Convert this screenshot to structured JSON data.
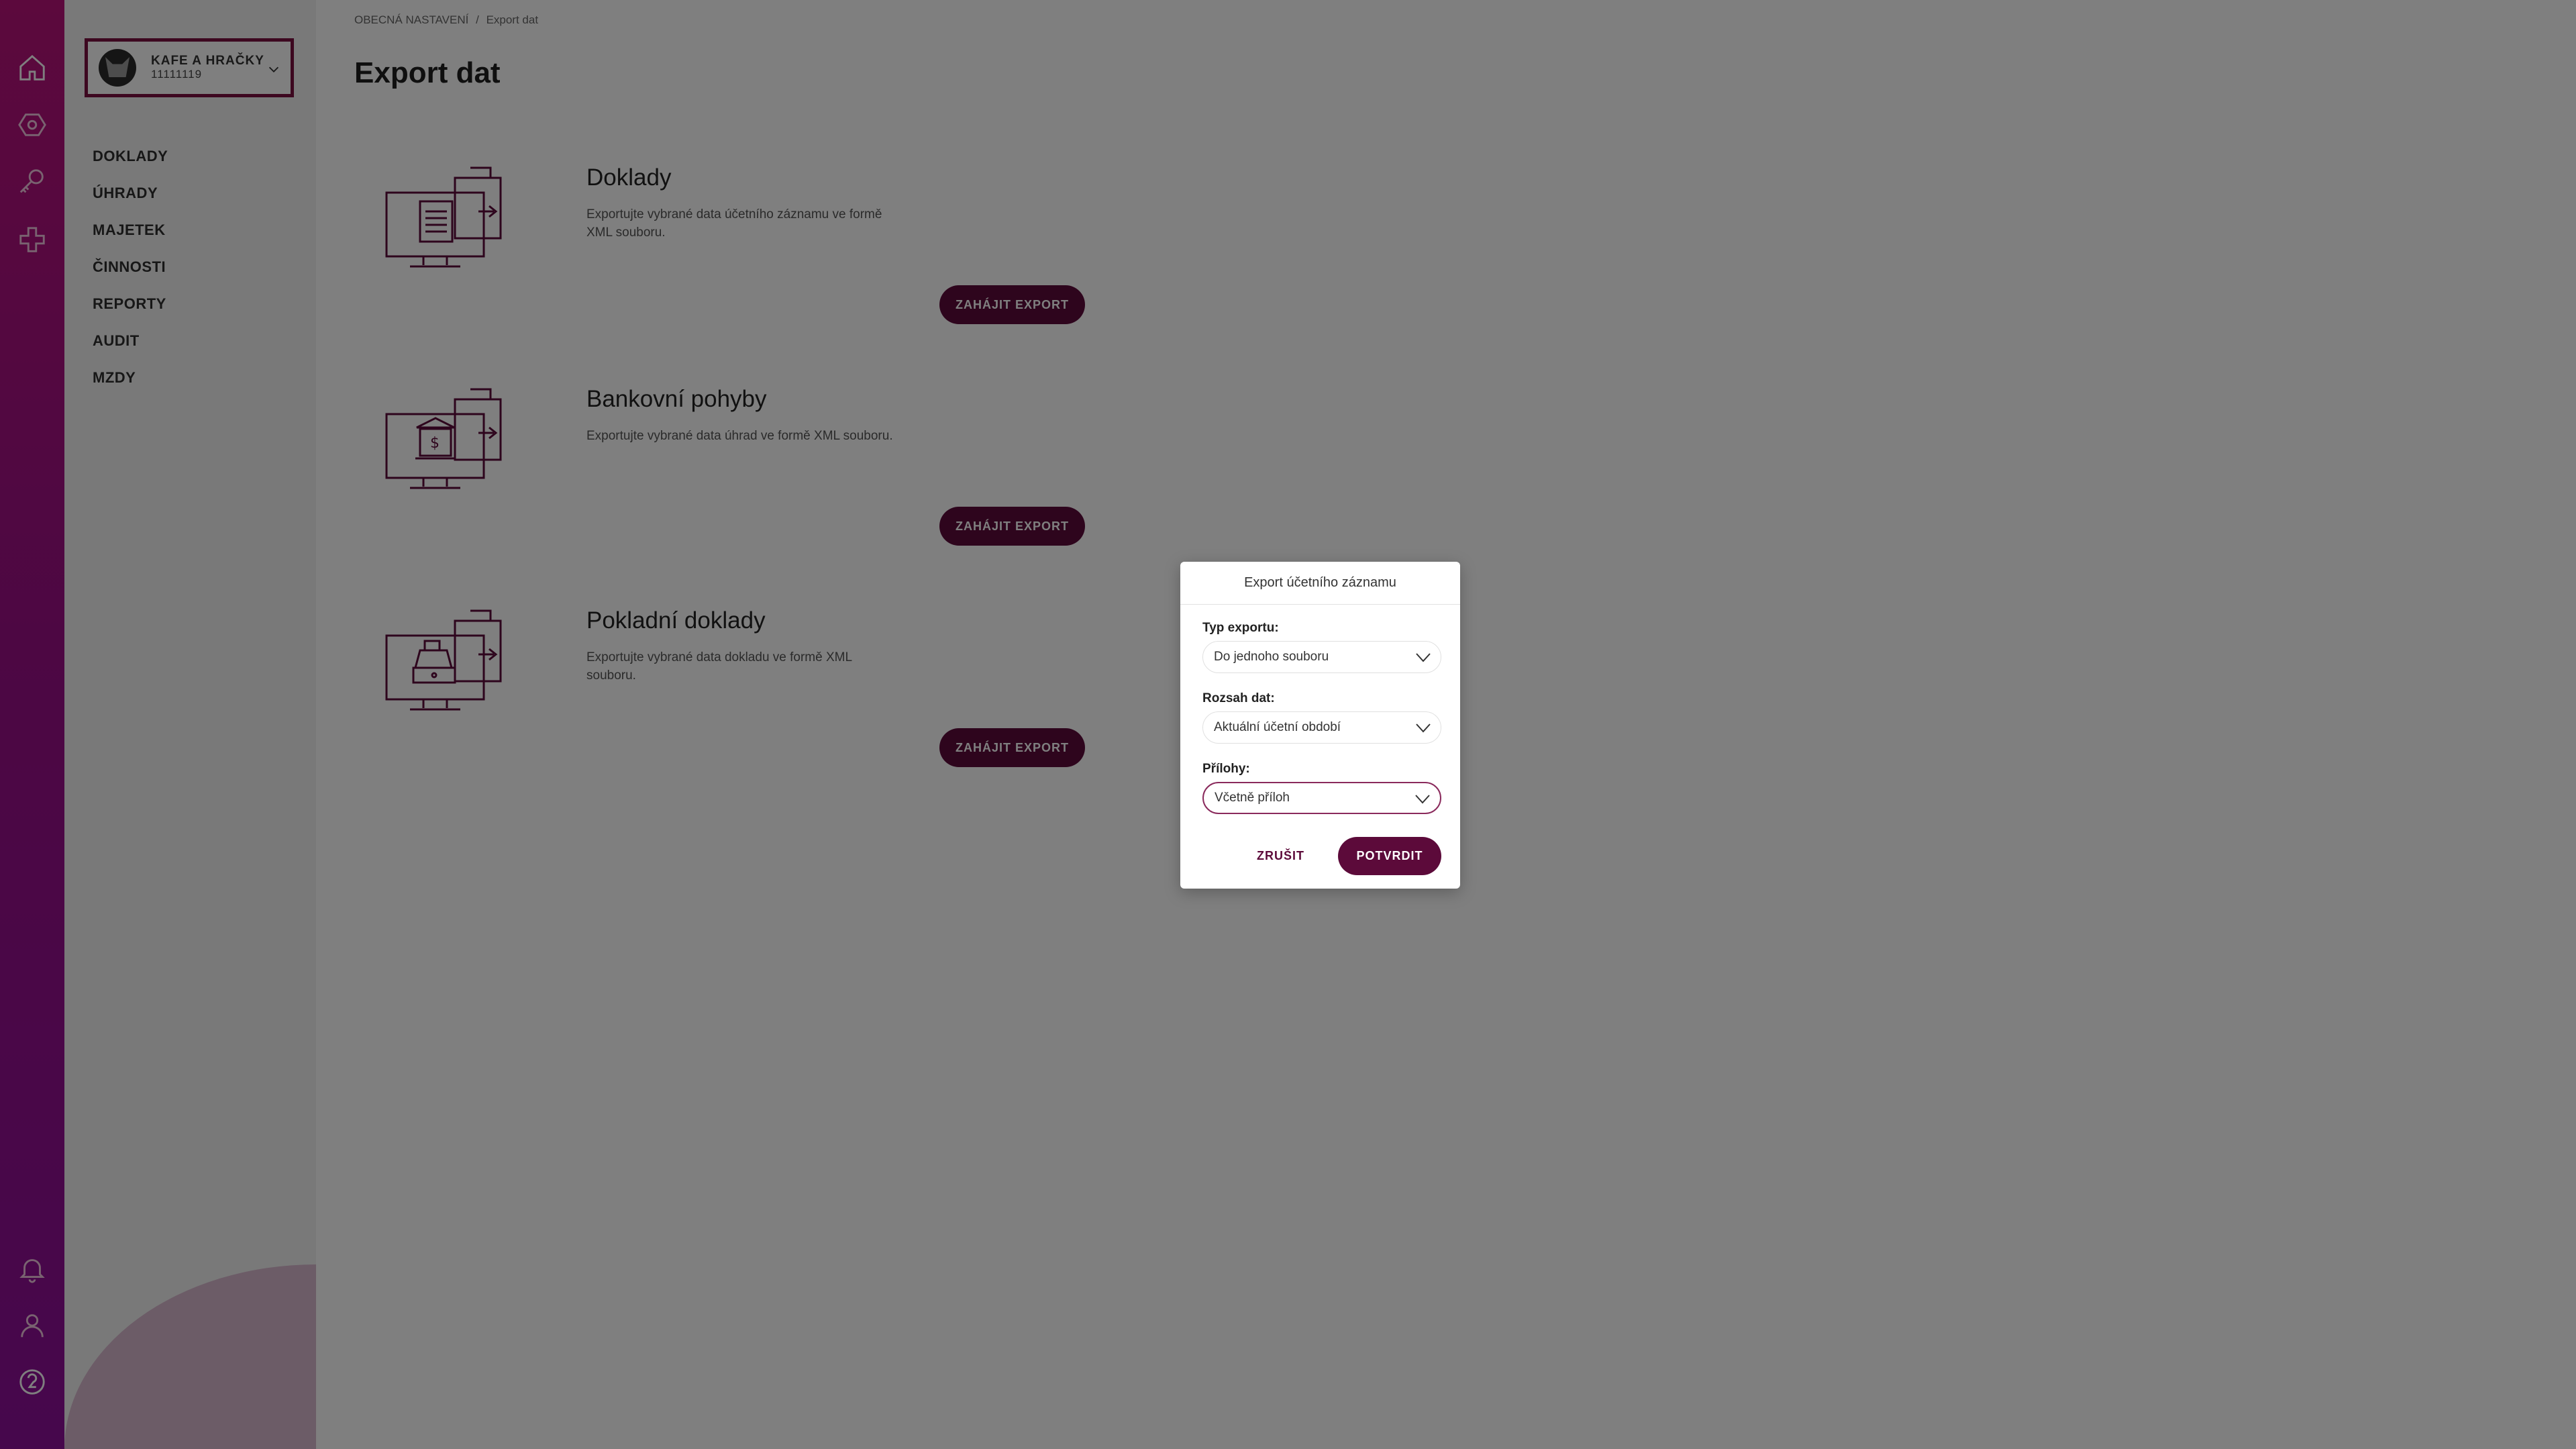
{
  "colors": {
    "accent": "#5c0a3a",
    "rail_top": "#b8127a",
    "rail_bottom": "#8d0e99",
    "company_border": "#7a1040"
  },
  "rail": {
    "top_icons": [
      "home-icon",
      "hexagon-icon",
      "key-icon",
      "plus-icon"
    ],
    "bottom_icons": [
      "bell-icon",
      "user-icon",
      "help-icon"
    ]
  },
  "company": {
    "name": "KAFE A HRAČKY",
    "id": "11111119"
  },
  "sidebar": {
    "items": [
      {
        "label": "DOKLADY"
      },
      {
        "label": "ÚHRADY"
      },
      {
        "label": "MAJETEK"
      },
      {
        "label": "ČINNOSTI"
      },
      {
        "label": "REPORTY"
      },
      {
        "label": "AUDIT"
      },
      {
        "label": "MZDY"
      }
    ]
  },
  "breadcrumb": {
    "parent": "OBECNÁ NASTAVENÍ",
    "separator": "/",
    "current": "Export dat"
  },
  "page": {
    "title": "Export dat"
  },
  "cards": [
    {
      "title": "Doklady",
      "description": "Exportujte vybrané data účetního záznamu ve formě XML souboru.",
      "button": "ZAHÁJIT EXPORT",
      "icon": "document-export-icon"
    },
    {
      "title": "Bankovní pohyby",
      "description": "Exportujte vybrané data úhrad ve formě XML souboru.",
      "button": "ZAHÁJIT EXPORT",
      "icon": "bank-export-icon"
    },
    {
      "title": "Pokladní doklady",
      "description": "Exportujte vybrané data dokladu ve formě XML souboru.",
      "button": "ZAHÁJIT EXPORT",
      "icon": "cash-register-export-icon"
    }
  ],
  "modal": {
    "title": "Export účetního záznamu",
    "fields": [
      {
        "label": "Typ exportu:",
        "value": "Do jednoho souboru"
      },
      {
        "label": "Rozsah dat:",
        "value": "Aktuální účetní období"
      },
      {
        "label": "Přílohy:",
        "value": "Včetně příloh"
      }
    ],
    "cancel": "ZRUŠIT",
    "confirm": "POTVRDIT"
  }
}
